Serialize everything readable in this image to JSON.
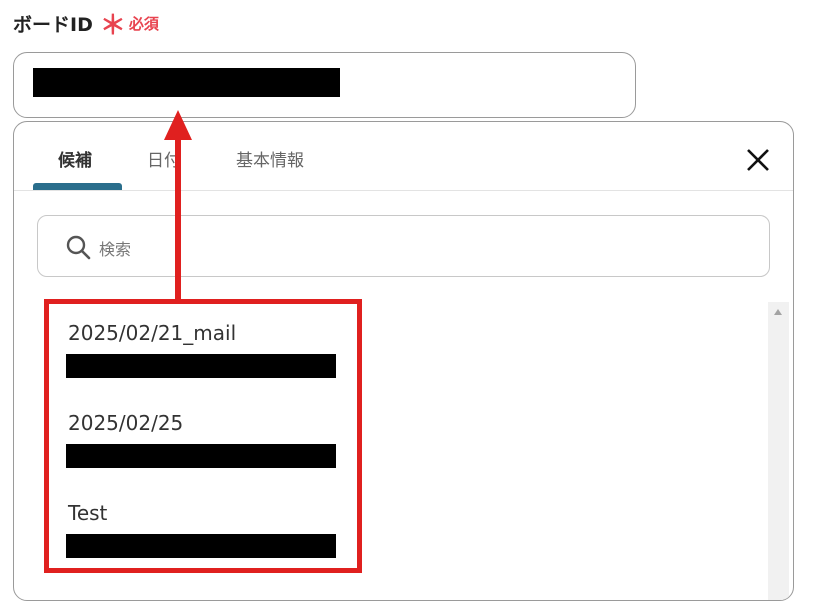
{
  "field": {
    "label": "ボードID",
    "required_mark": "＊",
    "required_text": "必須"
  },
  "tabs": [
    {
      "label": "候補",
      "active": true
    },
    {
      "label": "日付",
      "active": false
    },
    {
      "label": "基本情報",
      "active": false
    }
  ],
  "search": {
    "placeholder": "検索"
  },
  "items": [
    {
      "title": "2025/02/21_mail"
    },
    {
      "title": "2025/02/25"
    },
    {
      "title": "Test"
    }
  ],
  "colors": {
    "accent": "#2a6e8c",
    "required": "#e8434f",
    "annotation": "#e0201f"
  },
  "icons": {
    "close": "close-icon",
    "search": "search-icon",
    "scroll_up": "chevron-up-icon"
  }
}
